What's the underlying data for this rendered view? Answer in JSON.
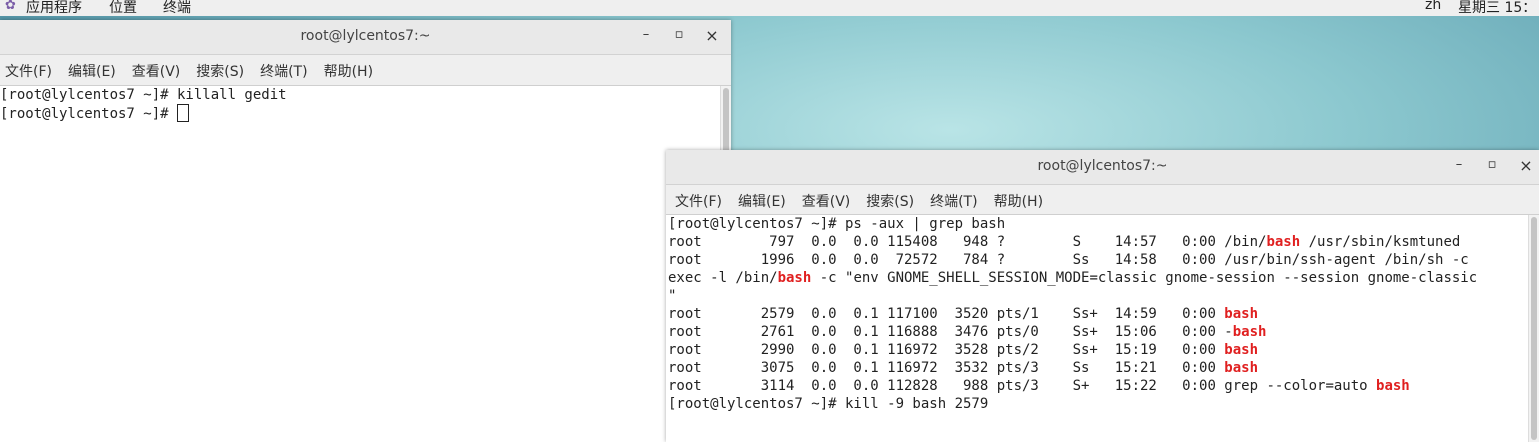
{
  "topbar": {
    "apps_label": "应用程序",
    "places_label": "位置",
    "terminal_label": "终端",
    "input_method": "zh",
    "clock": "星期三 15："
  },
  "window_back": {
    "title": "root@lylcentos7:~",
    "menu": [
      "文件(F)",
      "编辑(E)",
      "查看(V)",
      "搜索(S)",
      "终端(T)",
      "帮助(H)"
    ],
    "lines": [
      "[root@lylcentos7 ~]# killall gedit",
      "[root@lylcentos7 ~]# "
    ]
  },
  "window_front": {
    "title": "root@lylcentos7:~",
    "menu": [
      "文件(F)",
      "编辑(E)",
      "查看(V)",
      "搜索(S)",
      "终端(T)",
      "帮助(H)"
    ],
    "lines": [
      [
        {
          "t": "[root@lylcentos7 ~]# ps -aux | grep bash"
        }
      ],
      [
        {
          "t": "root        797  0.0  0.0 115408   948 ?        S    14:57   0:00 /bin/"
        },
        {
          "t": "bash",
          "hl": true
        },
        {
          "t": " /usr/sbin/ksmtuned"
        }
      ],
      [
        {
          "t": "root       1996  0.0  0.0  72572   784 ?        Ss   14:58   0:00 /usr/bin/ssh-agent /bin/sh -c"
        }
      ],
      [
        {
          "t": "exec -l /bin/"
        },
        {
          "t": "bash",
          "hl": true
        },
        {
          "t": " -c \"env GNOME_SHELL_SESSION_MODE=classic gnome-session --session gnome-classic"
        }
      ],
      [
        {
          "t": "\""
        }
      ],
      [
        {
          "t": "root       2579  0.0  0.1 117100  3520 pts/1    Ss+  14:59   0:00 "
        },
        {
          "t": "bash",
          "hl": true
        }
      ],
      [
        {
          "t": "root       2761  0.0  0.1 116888  3476 pts/0    Ss+  15:06   0:00 -"
        },
        {
          "t": "bash",
          "hl": true
        }
      ],
      [
        {
          "t": "root       2990  0.0  0.1 116972  3528 pts/2    Ss+  15:19   0:00 "
        },
        {
          "t": "bash",
          "hl": true
        }
      ],
      [
        {
          "t": "root       3075  0.0  0.1 116972  3532 pts/3    Ss   15:21   0:00 "
        },
        {
          "t": "bash",
          "hl": true
        }
      ],
      [
        {
          "t": "root       3114  0.0  0.0 112828   988 pts/3    S+   15:22   0:00 grep --color=auto "
        },
        {
          "t": "bash",
          "hl": true
        }
      ],
      [
        {
          "t": "[root@lylcentos7 ~]# kill -9 bash 2579"
        }
      ]
    ]
  },
  "window_buttons": {
    "minimize": "–",
    "maximize": "▫",
    "close": "×"
  },
  "icons": {
    "apps": "apps-icon",
    "minimize": "minimize-icon",
    "maximize": "maximize-icon",
    "close": "close-icon"
  }
}
